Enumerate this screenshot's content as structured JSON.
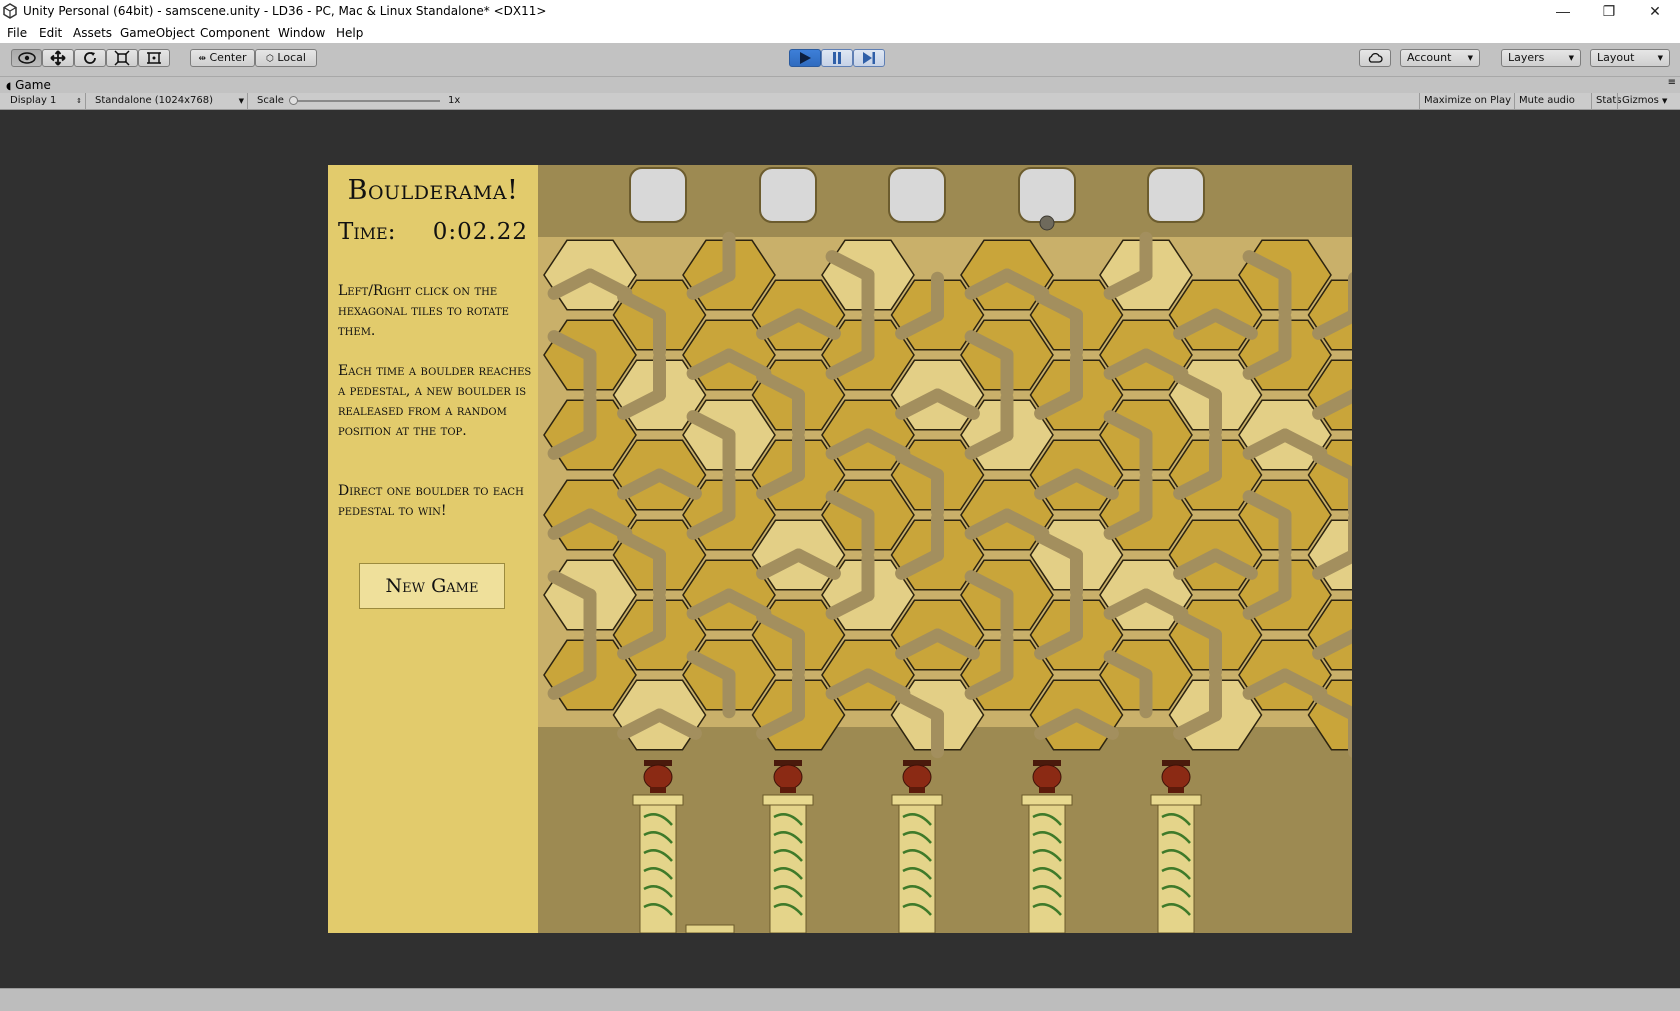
{
  "window": {
    "title": "Unity Personal (64bit) - samscene.unity - LD36 - PC, Mac & Linux Standalone* <DX11>",
    "minimize": "—",
    "restore": "❐",
    "close": "✕"
  },
  "menu": [
    "File",
    "Edit",
    "Assets",
    "GameObject",
    "Component",
    "Window",
    "Help"
  ],
  "toolbar": {
    "pivot_label": "Center",
    "space_label": "Local",
    "account_label": "Account",
    "layers_label": "Layers",
    "layout_label": "Layout",
    "play_state": "playing"
  },
  "game_view": {
    "tab_label": "Game",
    "display": "Display 1",
    "resolution": "Standalone (1024x768)",
    "scale_label": "Scale",
    "scale_value": "1x",
    "maximize_on_play": "Maximize on Play",
    "mute_audio": "Mute audio",
    "stats": "Stats",
    "gizmos": "Gizmos"
  },
  "game": {
    "title": "Boulderama!",
    "time_label": "Time:",
    "time_value": "0:02.22",
    "instructions": [
      "Left/Right click on the hexagonal tiles to rotate them.",
      "Each time a boulder reaches a pedestal, a new boulder is realeased from a random position at the top.",
      "Direct one boulder to each pedestal to win!"
    ],
    "new_game_label": "New Game",
    "drop_slots": 5,
    "pedestals": 5,
    "boulder_slot": 4
  },
  "colors": {
    "panel": "#e2cb6c",
    "board_bg": "#9d8a52",
    "tile": "#c9a53a",
    "path": "#a38f5e",
    "vase": "#8b2a14"
  }
}
